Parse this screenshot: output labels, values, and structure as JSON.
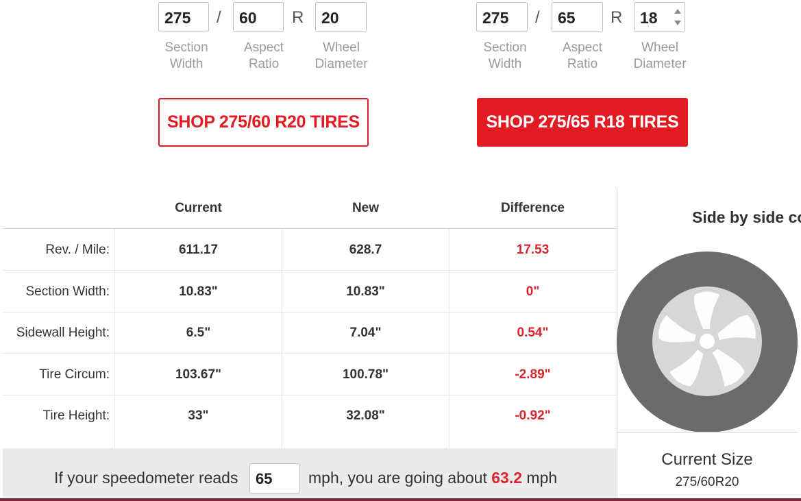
{
  "current_tire": {
    "section_width": "275",
    "separator": "/",
    "aspect_ratio": "60",
    "r_label": "R",
    "wheel_diameter": "20",
    "labels": {
      "section_width": [
        "Section",
        "Width"
      ],
      "aspect_ratio": [
        "Aspect",
        "Ratio"
      ],
      "wheel_diameter": [
        "Wheel",
        "Diameter"
      ]
    },
    "shop_label": "SHOP 275/60 R20 TIRES"
  },
  "new_tire": {
    "section_width": "275",
    "separator": "/",
    "aspect_ratio": "65",
    "r_label": "R",
    "wheel_diameter": "18",
    "labels": {
      "section_width": [
        "Section",
        "Width"
      ],
      "aspect_ratio": [
        "Aspect",
        "Ratio"
      ],
      "wheel_diameter": [
        "Wheel",
        "Diameter"
      ]
    },
    "shop_label": "SHOP 275/65 R18 TIRES"
  },
  "comparison": {
    "headers": {
      "current": "Current",
      "new": "New",
      "difference": "Difference"
    },
    "rows": [
      {
        "label": "Rev. / Mile:",
        "current": "611.17",
        "new": "628.7",
        "difference": "17.53"
      },
      {
        "label": "Section Width:",
        "current": "10.83\"",
        "new": "10.83\"",
        "difference": "0\""
      },
      {
        "label": "Sidewall Height:",
        "current": "6.5\"",
        "new": "7.04\"",
        "difference": "0.54\""
      },
      {
        "label": "Tire Circum:",
        "current": "103.67\"",
        "new": "100.78\"",
        "difference": "-2.89\""
      },
      {
        "label": "Tire Height:",
        "current": "33\"",
        "new": "32.08\"",
        "difference": "-0.92\""
      }
    ]
  },
  "speedometer": {
    "prefix": "If your speedometer reads",
    "input_value": "65",
    "middle": "mph, you are going about",
    "actual_speed": "63.2",
    "suffix": "mph"
  },
  "side_by_side": {
    "title": "Side by side co",
    "current_size_label": "Current Size",
    "current_size_value": "275/60R20",
    "icon": "tire-wheel-icon"
  },
  "colors": {
    "accent_red": "#e21a22",
    "difference_red": "#d9252e",
    "tire_gray": "#6b6b6b",
    "rim_gray": "#d7d7d7"
  }
}
